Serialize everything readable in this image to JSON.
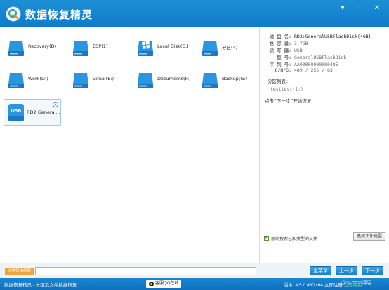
{
  "titlebar": {
    "title": "数据恢复精灵",
    "controls": [
      "▾",
      "—",
      "✕"
    ]
  },
  "drives": [
    {
      "label": "Recovery(D)",
      "type": "drive"
    },
    {
      "label": "ESP(1)",
      "type": "drive"
    },
    {
      "label": "Local Disk(C:)",
      "type": "windows"
    },
    {
      "label": "分区(4)",
      "type": "drive"
    },
    {
      "label": "Work(D:)",
      "type": "drive"
    },
    {
      "label": "Virual(E:)",
      "type": "drive"
    },
    {
      "label": "Documents(F:)",
      "type": "drive"
    },
    {
      "label": "Backup(G:)",
      "type": "drive"
    },
    {
      "label": "RD2:General...",
      "type": "usb",
      "badge": "USB",
      "selected": true
    }
  ],
  "info": {
    "rows": [
      {
        "key": "磁 盘 名:",
        "value": "RD2:GeneralUSBFlashDisk(4GB)"
      },
      {
        "key": "总 容 量:",
        "value": "3.7GB"
      },
      {
        "key": "读 写 器:",
        "value": "USB"
      },
      {
        "key": "型  号:",
        "value": "GeneralUSBFlashDisk"
      },
      {
        "key": "序 列 号:",
        "value": "AA00000000000485"
      },
      {
        "key": "C/H/S:",
        "value": "489 / 255 / 63"
      }
    ],
    "partition_title": "分区列表:",
    "partition_item": "testtest(I:)",
    "hint": "点击“下一步”开始恢复"
  },
  "options": {
    "checkbox_label": "额外搜索已知类型的文件",
    "filetype_button": "选择文件类型"
  },
  "bottom": {
    "path_label": "文件扫描结果",
    "path_value": "",
    "home_button": "主菜单",
    "prev_button": "上一步",
    "next_button": "下一步"
  },
  "status": {
    "left": "数据恢复精灵 - 分区及文件数据恢复",
    "center": "客服QQ在线",
    "version": "版本: 4.5.0.460 x64",
    "register": "立即注册",
    "buy": "立即购买",
    "watermark": "@51CTO博客"
  },
  "colors": {
    "titlebar": "#1a86d2",
    "accent": "#1a7fcf",
    "drive_icon": "#1e8ad6",
    "path_label": "#f0a33a"
  }
}
